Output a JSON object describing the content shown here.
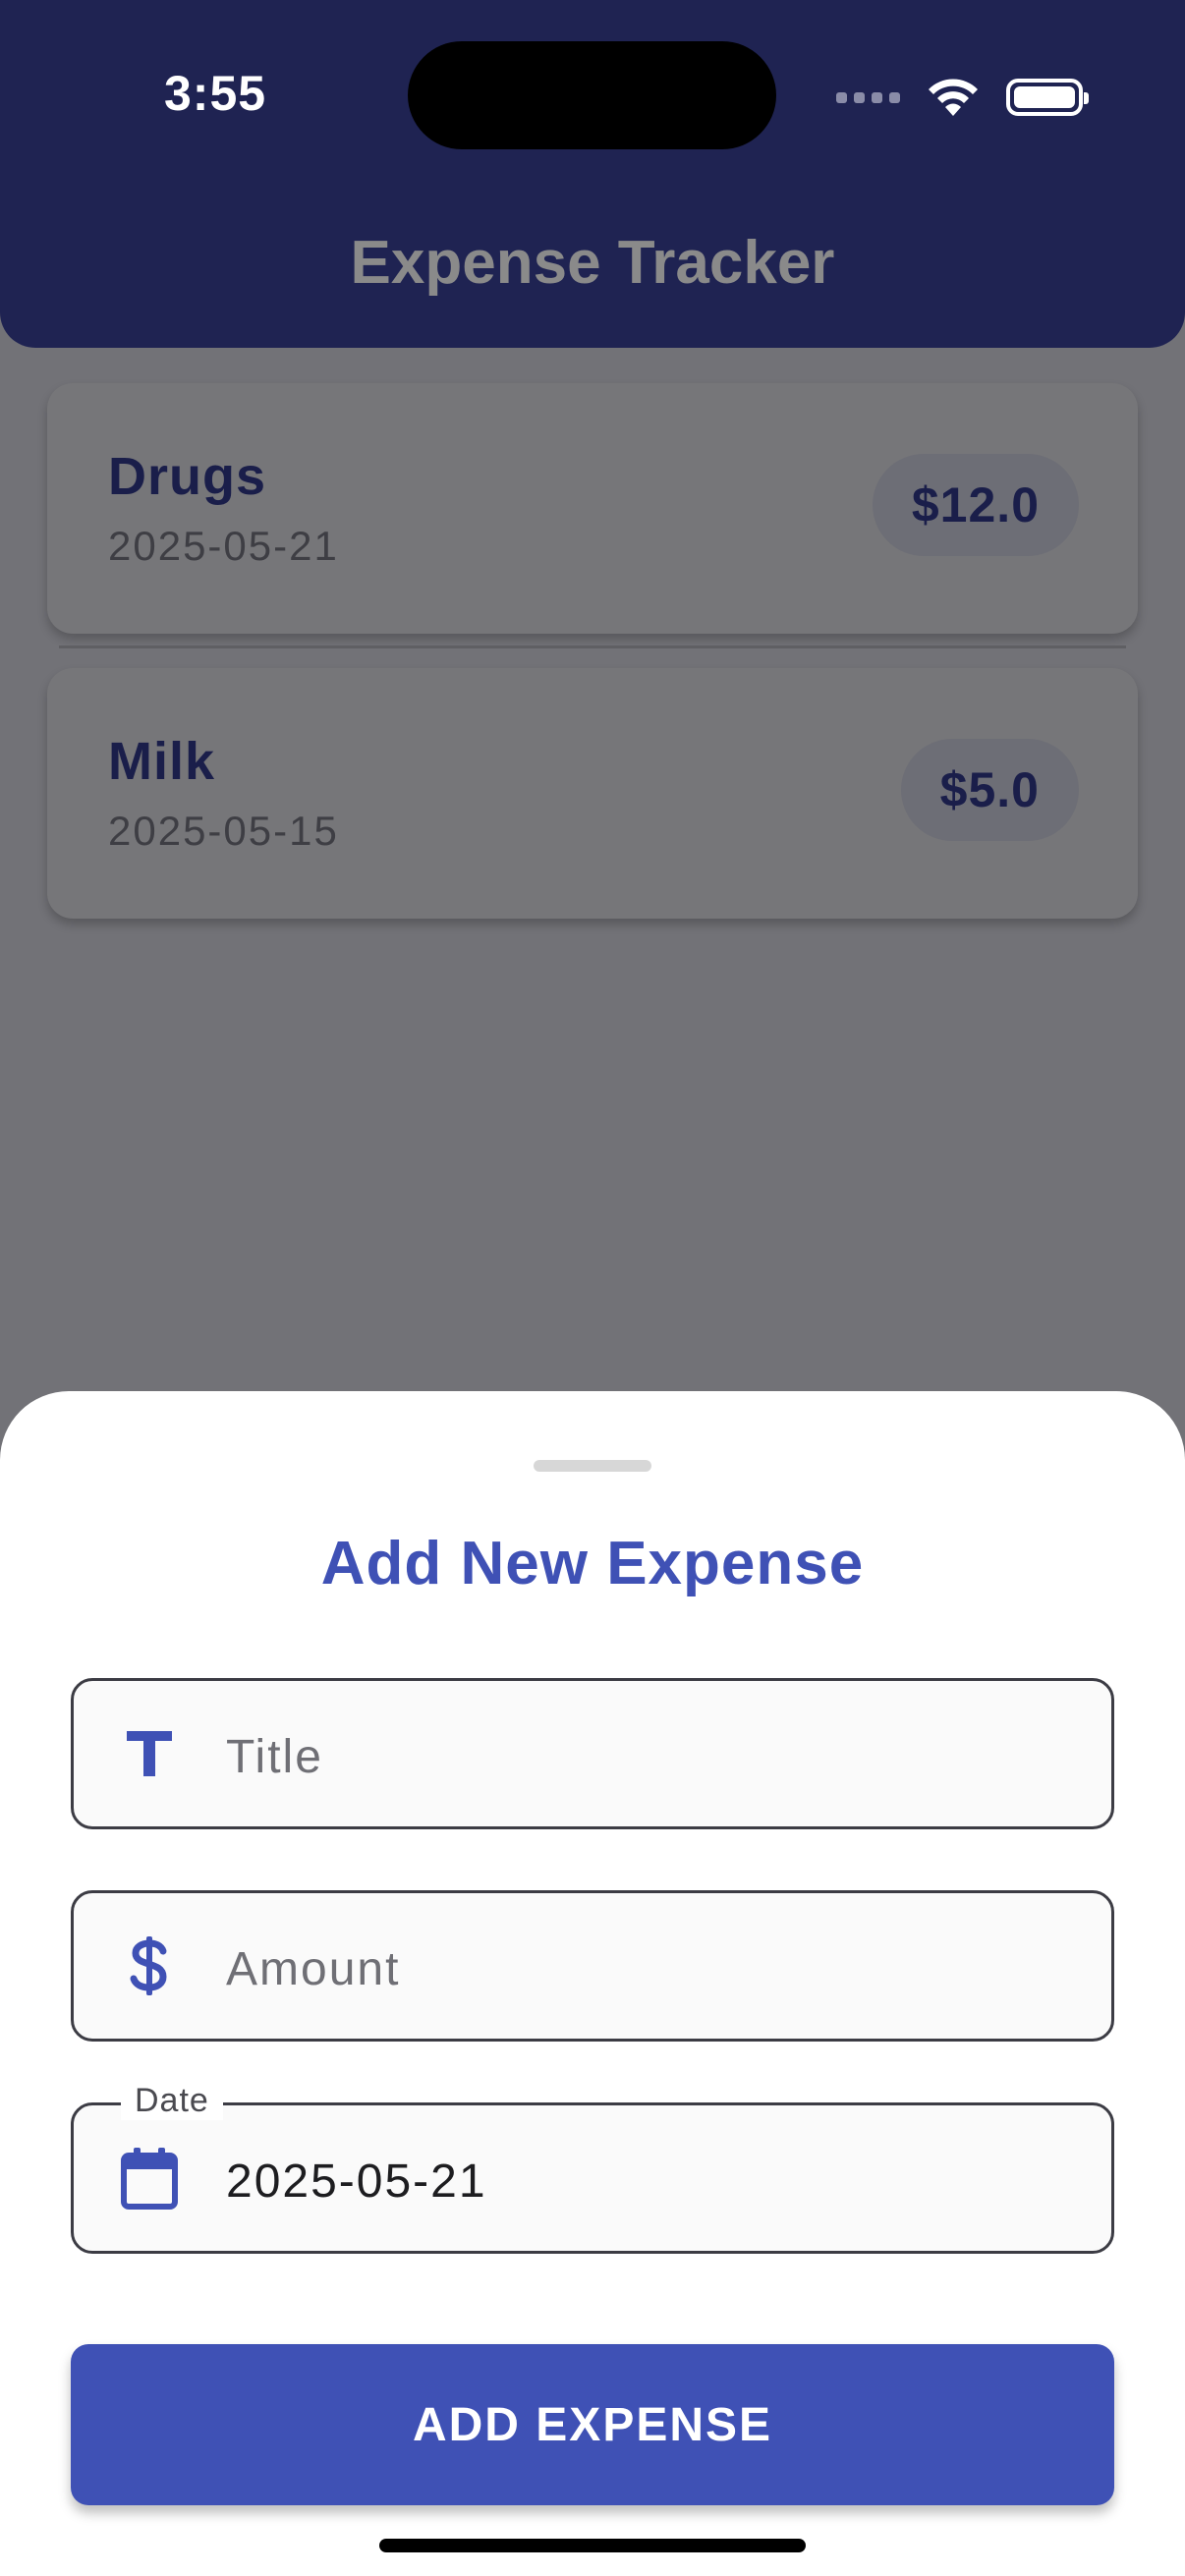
{
  "status_bar": {
    "time": "3:55"
  },
  "header": {
    "title": "Expense Tracker",
    "background_color": "#1f2352"
  },
  "expenses": [
    {
      "title": "Drugs",
      "date": "2025-05-21",
      "amount": "$12.0"
    },
    {
      "title": "Milk",
      "date": "2025-05-15",
      "amount": "$5.0"
    }
  ],
  "sheet": {
    "title": "Add New Expense",
    "title_field": {
      "icon": "title-text-icon",
      "placeholder": "Title"
    },
    "amount_field": {
      "icon": "dollar-icon",
      "placeholder": "Amount"
    },
    "date_field": {
      "icon": "calendar-icon",
      "label": "Date",
      "value": "2025-05-21"
    },
    "submit_label": "ADD EXPENSE",
    "accent_color": "#3f51b5"
  }
}
